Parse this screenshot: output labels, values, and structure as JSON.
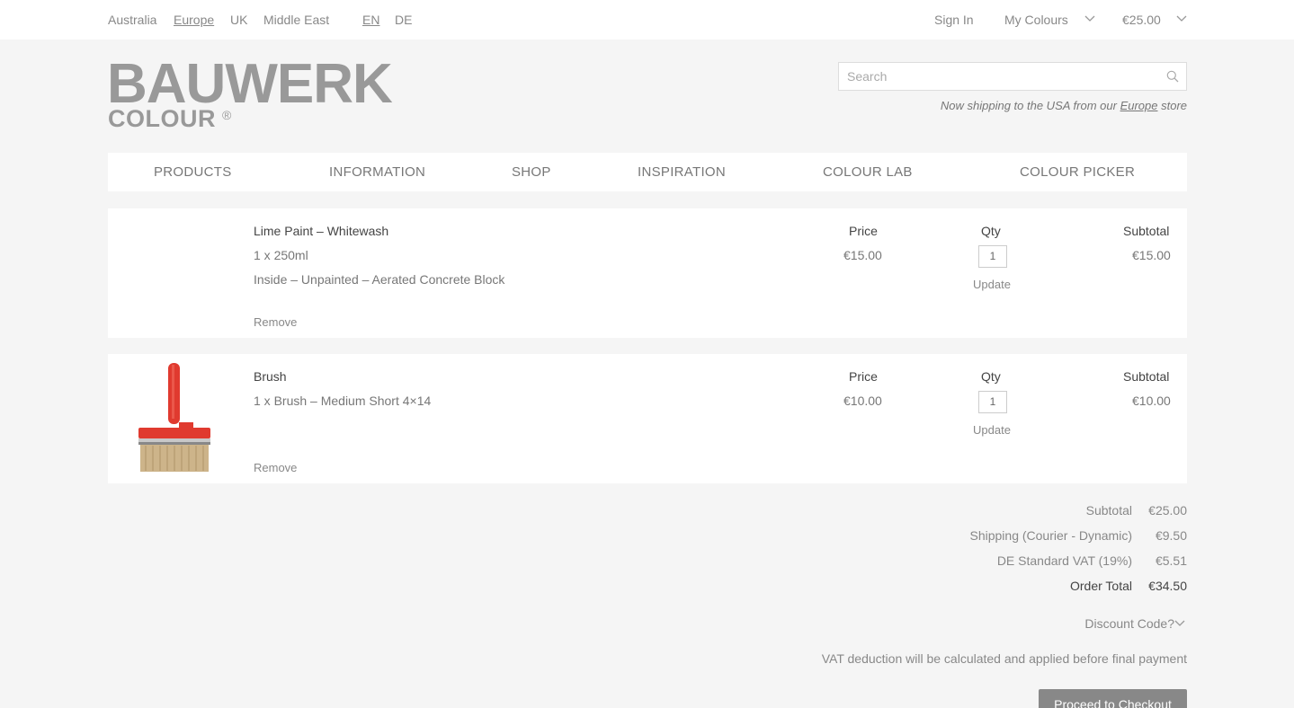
{
  "topbar": {
    "regions": [
      "Australia",
      "Europe",
      "UK",
      "Middle East"
    ],
    "languages": [
      "EN",
      "DE"
    ],
    "sign_in": "Sign In",
    "my_colours": "My Colours",
    "cart_total": "€25.00"
  },
  "header": {
    "logo_main": "BAUWERK",
    "logo_sub": "COLOUR",
    "logo_reg": "®",
    "search_placeholder": "Search",
    "ship_note_pre": "Now shipping to the USA from our ",
    "ship_note_link": "Europe",
    "ship_note_post": " store"
  },
  "nav": [
    "PRODUCTS",
    "INFORMATION",
    "SHOP",
    "INSPIRATION",
    "COLOUR LAB",
    "COLOUR PICKER"
  ],
  "cart": {
    "items": [
      {
        "name": "Lime Paint – Whitewash",
        "detail1": "1 x 250ml",
        "detail2": "Inside – Unpainted – Aerated Concrete Block",
        "price_label": "Price",
        "price": "€15.00",
        "qty_label": "Qty",
        "qty": "1",
        "update": "Update",
        "subtotal_label": "Subtotal",
        "subtotal": "€15.00",
        "remove": "Remove"
      },
      {
        "name": "Brush",
        "detail1": "1 x Brush – Medium Short 4×14",
        "price_label": "Price",
        "price": "€10.00",
        "qty_label": "Qty",
        "qty": "1",
        "update": "Update",
        "subtotal_label": "Subtotal",
        "subtotal": "€10.00",
        "remove": "Remove"
      }
    ]
  },
  "totals": {
    "subtotal_label": "Subtotal",
    "subtotal": "€25.00",
    "shipping_label": "Shipping (Courier - Dynamic)",
    "shipping": "€9.50",
    "vat_label": "DE Standard VAT (19%)",
    "vat": "€5.51",
    "order_total_label": "Order Total",
    "order_total": "€34.50"
  },
  "discount_label": "Discount Code?",
  "vat_note": "VAT deduction will be calculated and applied before final payment",
  "checkout_label": "Proceed to Checkout",
  "colors": {
    "background": "#f5f5f5",
    "panel": "#ffffff",
    "text": "#555555",
    "button": "#888888",
    "brush_handle": "#e03a2f"
  }
}
